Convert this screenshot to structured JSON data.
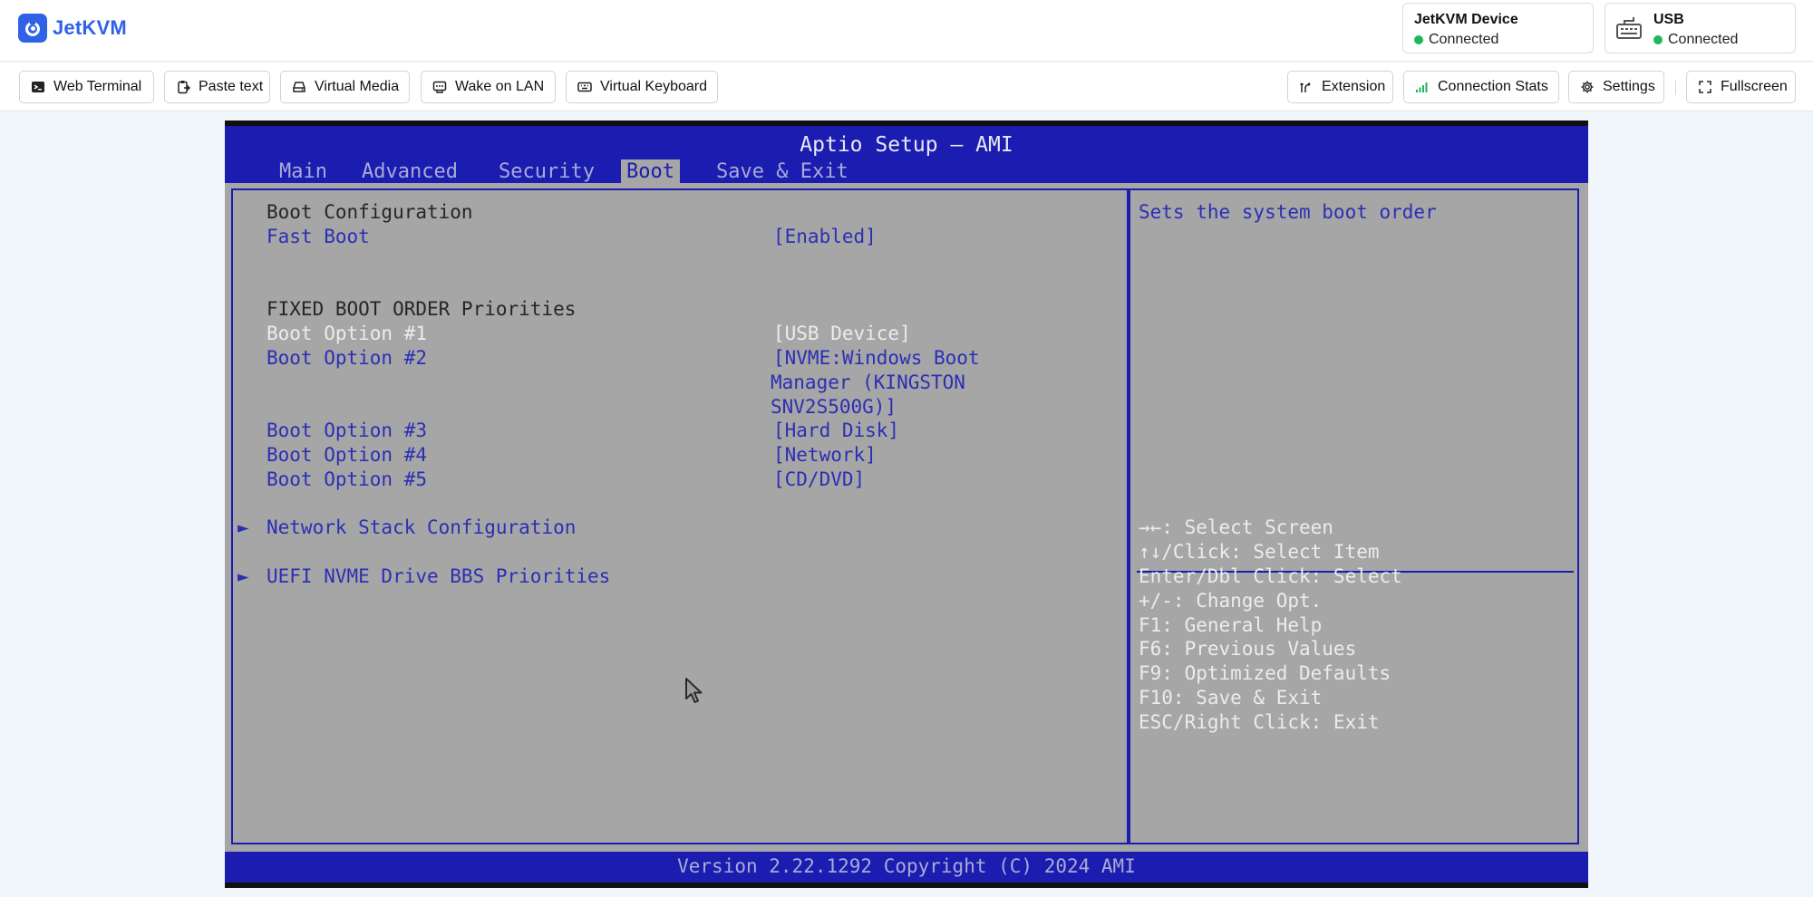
{
  "app": {
    "name": "JetKVM"
  },
  "status": {
    "device": {
      "title": "JetKVM Device",
      "status": "Connected"
    },
    "usb": {
      "title": "USB",
      "status": "Connected"
    },
    "status_color": "#1fb65c"
  },
  "toolbar": {
    "left": [
      {
        "label": "Web Terminal",
        "icon": "terminal-icon"
      },
      {
        "label": "Paste text",
        "icon": "clipboard-icon"
      },
      {
        "label": "Virtual Media",
        "icon": "drive-icon"
      },
      {
        "label": "Wake on LAN",
        "icon": "ethernet-icon"
      },
      {
        "label": "Virtual Keyboard",
        "icon": "keyboard-icon"
      }
    ],
    "right": [
      {
        "label": "Extension",
        "icon": "extension-icon"
      },
      {
        "label": "Connection Stats",
        "icon": "signal-icon"
      },
      {
        "label": "Settings",
        "icon": "gear-icon"
      },
      {
        "label": "Fullscreen",
        "icon": "fullscreen-icon"
      }
    ]
  },
  "bios": {
    "title": "Aptio Setup – AMI",
    "tabs": [
      "Main",
      "Advanced",
      "Security",
      "Boot",
      "Save & Exit"
    ],
    "active_tab": "Boot",
    "section_boot_config": "Boot Configuration",
    "fast_boot": {
      "label": "Fast Boot",
      "value": "[Enabled]"
    },
    "section_fixed_order": "FIXED BOOT ORDER Priorities",
    "boot_options": [
      {
        "label": "Boot Option #1",
        "value": "[USB Device]"
      },
      {
        "label": "Boot Option #2",
        "value": "[NVME:Windows Boot",
        "value2": "Manager (KINGSTON",
        "value3": "SNV2S500G)]"
      },
      {
        "label": "Boot Option #3",
        "value": "[Hard Disk]"
      },
      {
        "label": "Boot Option #4",
        "value": "[Network]"
      },
      {
        "label": "Boot Option #5",
        "value": "[CD/DVD]"
      }
    ],
    "submenus": [
      "Network Stack Configuration",
      "UEFI NVME Drive BBS Priorities"
    ],
    "help_text": "Sets the system boot order",
    "key_help": [
      "→←: Select Screen",
      "↑↓/Click: Select Item",
      "Enter/Dbl Click: Select",
      "+/-: Change Opt.",
      "F1: General Help",
      "F6: Previous Values",
      "F9: Optimized Defaults",
      "F10: Save & Exit",
      "ESC/Right Click: Exit"
    ],
    "footer": "Version 2.22.1292 Copyright (C) 2024 AMI",
    "colors": {
      "blue": "#1b1cb0",
      "gray": "#a6a6a6"
    }
  }
}
